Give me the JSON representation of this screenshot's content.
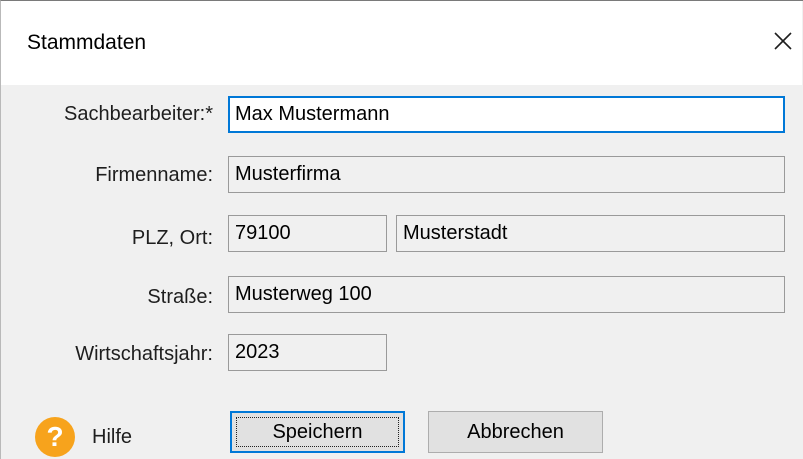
{
  "window": {
    "title": "Stammdaten",
    "close_label": "×"
  },
  "form": {
    "sachbearbeiter": {
      "label": "Sachbearbeiter:*",
      "value": "Max Mustermann"
    },
    "firmenname": {
      "label": "Firmenname:",
      "value": "Musterfirma"
    },
    "plz_ort": {
      "label": "PLZ, Ort:",
      "plz_value": "79100",
      "ort_value": "Musterstadt"
    },
    "strasse": {
      "label": "Straße:",
      "value": "Musterweg 100"
    },
    "wirtschaftsjahr": {
      "label": "Wirtschaftsjahr:",
      "value": "2023"
    }
  },
  "footer": {
    "help_icon_glyph": "?",
    "help_label": "Hilfe",
    "save_label": "Speichern",
    "cancel_label": "Abbrechen"
  },
  "colors": {
    "accent": "#0078d7",
    "help_icon": "#f7a31c",
    "dialog_background": "#f0f0f0",
    "titlebar_background": "#ffffff"
  },
  "icons": {
    "close": "close-icon",
    "help": "help-icon"
  }
}
